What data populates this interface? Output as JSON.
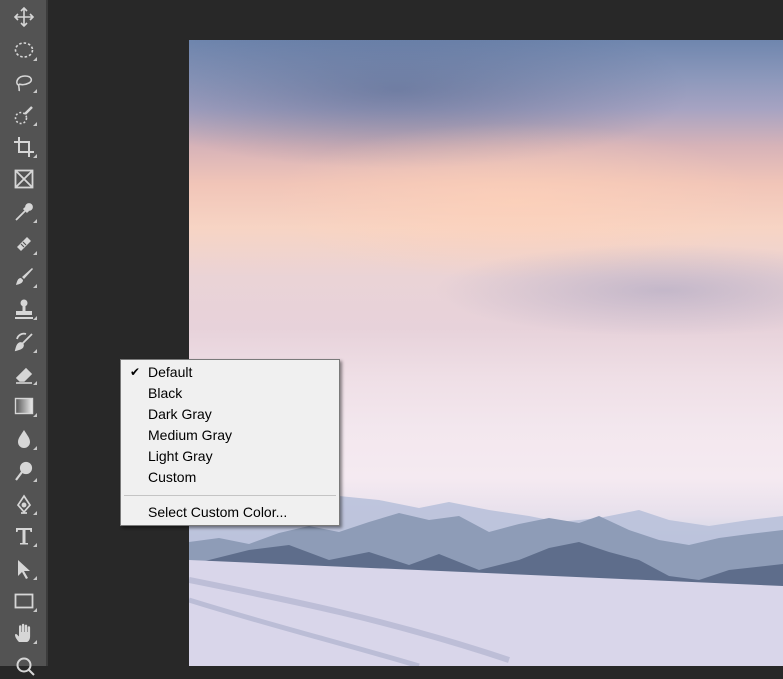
{
  "toolbar": {
    "tools": [
      {
        "name": "move-tool-icon"
      },
      {
        "name": "elliptical-marquee-tool-icon"
      },
      {
        "name": "lasso-tool-icon"
      },
      {
        "name": "quick-selection-tool-icon"
      },
      {
        "name": "crop-tool-icon"
      },
      {
        "name": "frame-tool-icon"
      },
      {
        "name": "eyedropper-tool-icon"
      },
      {
        "name": "healing-brush-tool-icon"
      },
      {
        "name": "brush-tool-icon"
      },
      {
        "name": "clone-stamp-tool-icon"
      },
      {
        "name": "history-brush-tool-icon"
      },
      {
        "name": "eraser-tool-icon"
      },
      {
        "name": "gradient-tool-icon"
      },
      {
        "name": "blur-tool-icon"
      },
      {
        "name": "dodge-tool-icon"
      },
      {
        "name": "pen-tool-icon"
      },
      {
        "name": "type-tool-icon"
      },
      {
        "name": "path-selection-tool-icon"
      },
      {
        "name": "rectangle-tool-icon"
      },
      {
        "name": "hand-tool-icon"
      },
      {
        "name": "zoom-tool-icon"
      }
    ],
    "icon_color": "#d6d6d6"
  },
  "context_menu": {
    "items": [
      {
        "label": "Default",
        "checked": true,
        "check_glyph": "✔"
      },
      {
        "label": "Black"
      },
      {
        "label": "Dark Gray"
      },
      {
        "label": "Medium Gray"
      },
      {
        "label": "Light Gray"
      },
      {
        "label": "Custom"
      }
    ],
    "select_custom_color_label": "Select Custom Color..."
  },
  "colors": {
    "toolbar_bg": "#535353",
    "pasteboard_bg": "#282828",
    "menu_bg": "#f0f0f0"
  }
}
